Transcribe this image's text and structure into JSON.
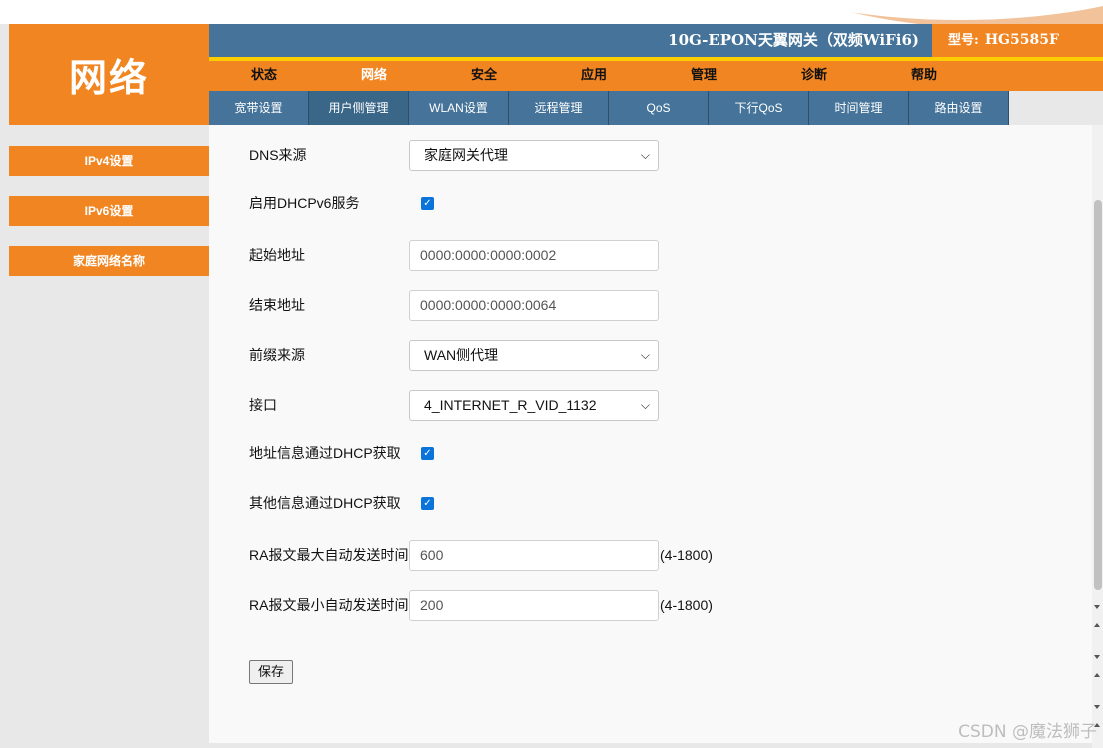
{
  "header": {
    "logo_text": "网络",
    "device_name": "10G-EPON天翼网关（双频WiFi6)",
    "model_label": "型号:",
    "model_value": "HG5585F"
  },
  "main_nav": [
    "状态",
    "网络",
    "安全",
    "应用",
    "管理",
    "诊断",
    "帮助"
  ],
  "main_nav_active": "网络",
  "sub_nav": [
    "宽带设置",
    "用户侧管理",
    "WLAN设置",
    "远程管理",
    "QoS",
    "下行QoS",
    "时间管理",
    "路由设置"
  ],
  "sub_nav_active": "用户侧管理",
  "sidebar": [
    "IPv4设置",
    "IPv6设置",
    "家庭网络名称"
  ],
  "form": {
    "dns_source_label": "DNS来源",
    "dns_source_value": "家庭网关代理",
    "dhcpv6_label": "启用DHCPv6服务",
    "dhcpv6_checked": true,
    "start_addr_label": "起始地址",
    "start_addr_value": "0000:0000:0000:0002",
    "end_addr_label": "结束地址",
    "end_addr_value": "0000:0000:0000:0064",
    "prefix_source_label": "前缀来源",
    "prefix_source_value": "WAN侧代理",
    "interface_label": "接口",
    "interface_value": "4_INTERNET_R_VID_1132",
    "addr_info_dhcp_label": "地址信息通过DHCP获取",
    "addr_info_dhcp_checked": true,
    "other_info_dhcp_label": "其他信息通过DHCP获取",
    "other_info_dhcp_checked": true,
    "ra_max_label": "RA报文最大自动发送时间",
    "ra_max_value": "600",
    "ra_max_hint": "(4-1800)",
    "ra_min_label": "RA报文最小自动发送时间",
    "ra_min_value": "200",
    "ra_min_hint": "(4-1800)",
    "save_label": "保存"
  },
  "watermark": "CSDN @魔法狮子",
  "colors": {
    "orange": "#f08522",
    "steel_blue": "#457399",
    "yellow_line": "#ffcc00",
    "checkbox_blue": "#0a74da"
  }
}
